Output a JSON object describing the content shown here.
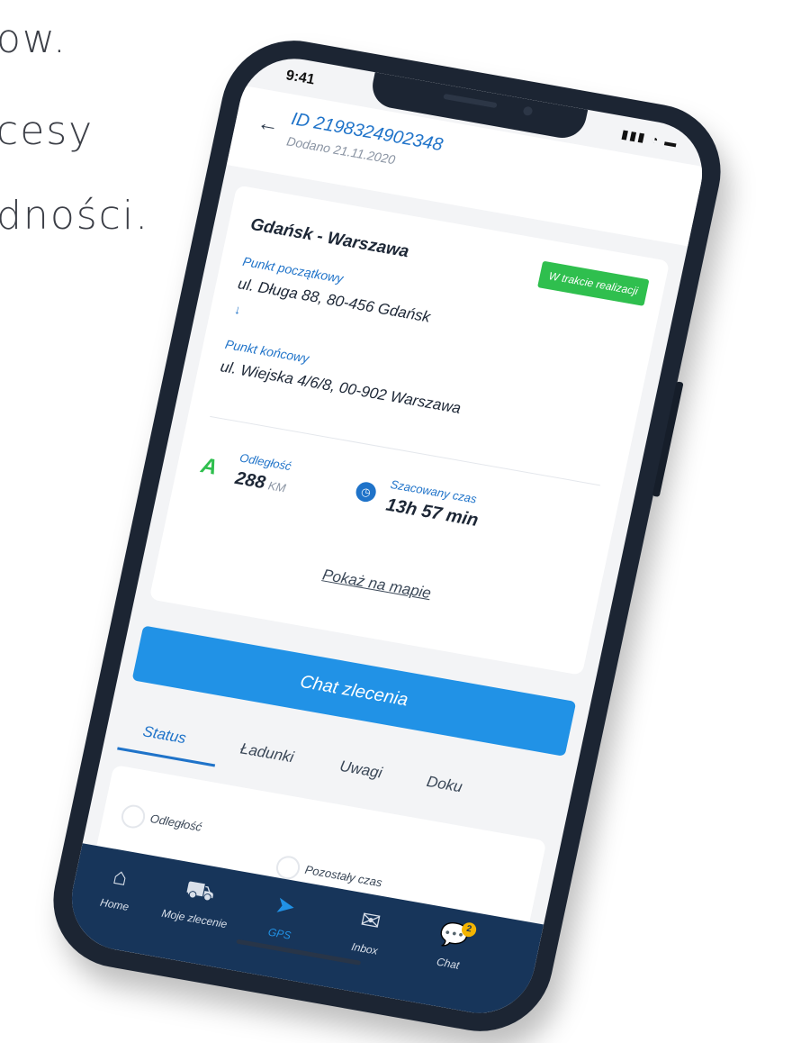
{
  "background": {
    "line1": "ow.",
    "line2": "cesy",
    "line3": "dności."
  },
  "statusbar": {
    "time": "9:41",
    "icons": "signal wifi battery"
  },
  "header": {
    "order_id": "ID 2198324902348",
    "added": "Dodano 21.11.2020"
  },
  "order": {
    "route": "Gdańsk - Warszawa",
    "status": "W trakcie realizacji",
    "start_label": "Punkt początkowy",
    "start_value": "ul. Długa 88,  80-456 Gdańsk",
    "end_label": "Punkt końcowy",
    "end_value": "ul. Wiejska 4/6/8,  00-902 Warszawa",
    "distance_label": "Odległość",
    "distance_value": "288",
    "distance_unit": "KM",
    "time_label": "Szacowany czas",
    "time_value": "13h 57 min",
    "map_link": "Pokaż na mapie"
  },
  "chat_button": "Chat zlecenia",
  "tabs": [
    "Status",
    "Ładunki",
    "Uwagi",
    "Doku"
  ],
  "lower": {
    "distance_label": "Odległość",
    "remaining_label": "Pozostały czas"
  },
  "nav": {
    "home": "Home",
    "orders": "Moje zlecenie",
    "gps": "GPS",
    "inbox": "Inbox",
    "chat": "Chat",
    "chat_badge": "2"
  },
  "colors": {
    "accent": "#2192e6",
    "status_green": "#2fbf4e",
    "nav_bg": "#17355a",
    "phone_body": "#1c2533"
  }
}
